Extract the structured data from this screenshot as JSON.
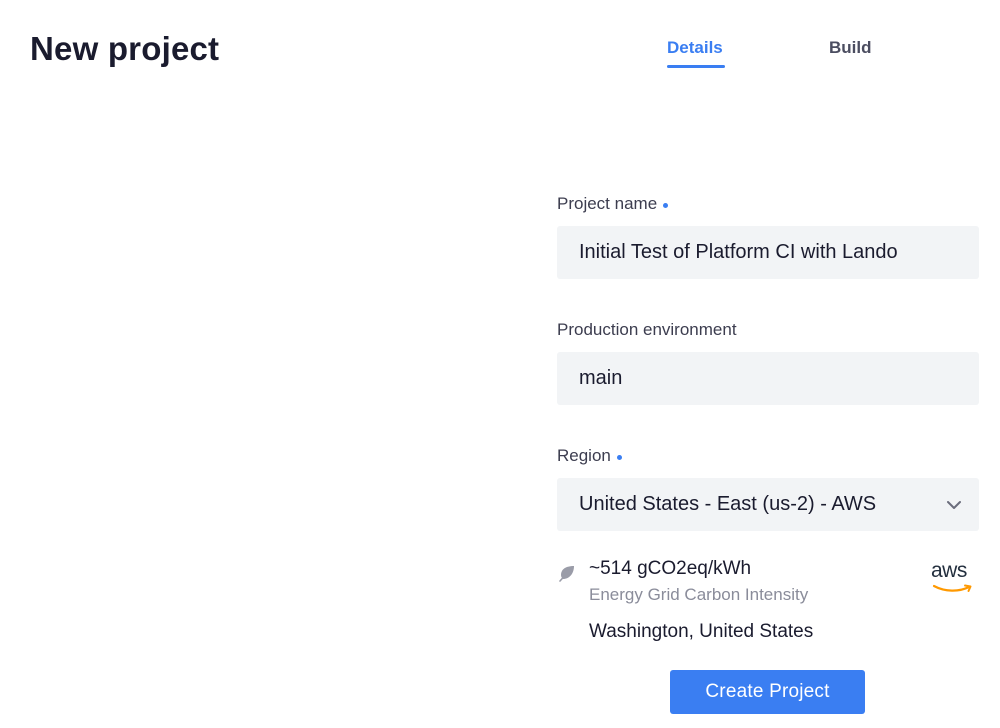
{
  "header": {
    "title": "New project",
    "tabs": [
      {
        "label": "Details",
        "active": true
      },
      {
        "label": "Build",
        "active": false
      }
    ]
  },
  "form": {
    "project_name": {
      "label": "Project name",
      "required": true,
      "value": "Initial Test of Platform CI with Lando"
    },
    "production_environment": {
      "label": "Production environment",
      "required": false,
      "value": "main"
    },
    "region": {
      "label": "Region",
      "required": true,
      "selected": "United States - East (us-2) - AWS",
      "carbon_intensity": "~514 gCO2eq/kWh",
      "carbon_caption": "Energy Grid Carbon Intensity",
      "location": "Washington, United States",
      "provider_logo": "aws",
      "icons": {
        "leaf": "leaf-icon",
        "chevron": "chevron-down-icon"
      }
    },
    "submit_label": "Create Project"
  },
  "colors": {
    "accent": "#3a7ef2",
    "input_bg": "#f2f4f6",
    "text": "#1a1b2e",
    "muted": "#8a8c9a",
    "aws_orange": "#ff9900"
  }
}
